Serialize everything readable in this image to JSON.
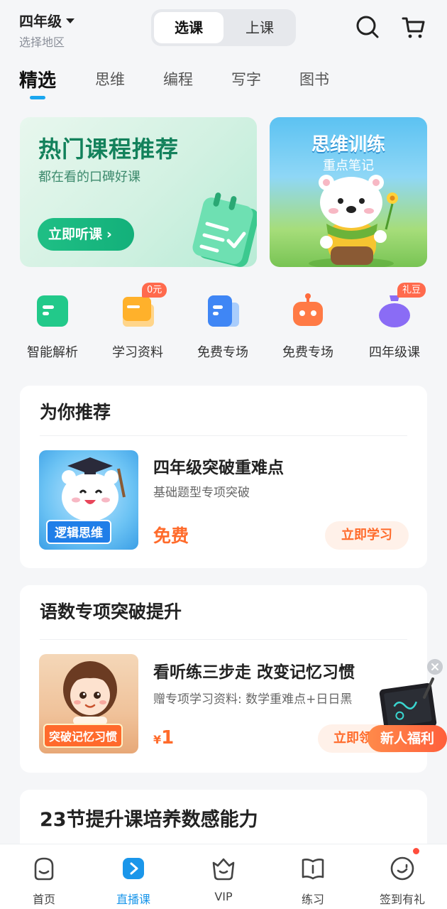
{
  "header": {
    "grade": "四年级",
    "region": "选择地区",
    "segments": [
      "选课",
      "上课"
    ]
  },
  "tabs": [
    "精选",
    "思维",
    "编程",
    "写字",
    "图书"
  ],
  "banners": {
    "left": {
      "title": "热门课程推荐",
      "subtitle": "都在看的口碑好课",
      "button": "立即听课"
    },
    "right": {
      "title": "思维训练",
      "subtitle": "重点笔记"
    }
  },
  "quick": [
    {
      "label": "智能解析",
      "icon": "analysis-icon",
      "badge": ""
    },
    {
      "label": "学习资料",
      "icon": "materials-icon",
      "badge": "0元"
    },
    {
      "label": "免费专场",
      "icon": "free-doc-icon",
      "badge": ""
    },
    {
      "label": "免费专场",
      "icon": "robot-icon",
      "badge": ""
    },
    {
      "label": "四年级课",
      "icon": "bag-icon",
      "badge": "礼豆"
    }
  ],
  "recommend": {
    "title": "为你推荐",
    "course": {
      "thumb_label": "逻辑思维",
      "title": "四年级突破重难点",
      "subtitle": "基础题型专项突破",
      "price": "免费",
      "button": "立即学习"
    }
  },
  "special": {
    "title": "语数专项突破提升",
    "course": {
      "thumb_label": "突破记忆习惯",
      "title": "看听练三步走 改变记忆习惯",
      "subtitle": "赠专项学习资料: 数学重难点+日日黑",
      "price_symbol": "¥",
      "price": "1",
      "button": "立即领"
    }
  },
  "third": {
    "title": "23节提升课培养数感能力"
  },
  "floating": {
    "label": "新人福利"
  },
  "nav": [
    {
      "label": "首页",
      "icon": "home-face-icon",
      "active": false
    },
    {
      "label": "直播课",
      "icon": "live-play-icon",
      "active": true
    },
    {
      "label": "VIP",
      "icon": "vip-crown-icon",
      "active": false
    },
    {
      "label": "练习",
      "icon": "practice-book-icon",
      "active": false
    },
    {
      "label": "签到有礼",
      "icon": "checkin-smile-icon",
      "active": false
    }
  ],
  "colors": {
    "accent": "#1aa6ef",
    "green": "#13b07a",
    "orange": "#ff6b2b",
    "background": "#f5f6f8"
  }
}
